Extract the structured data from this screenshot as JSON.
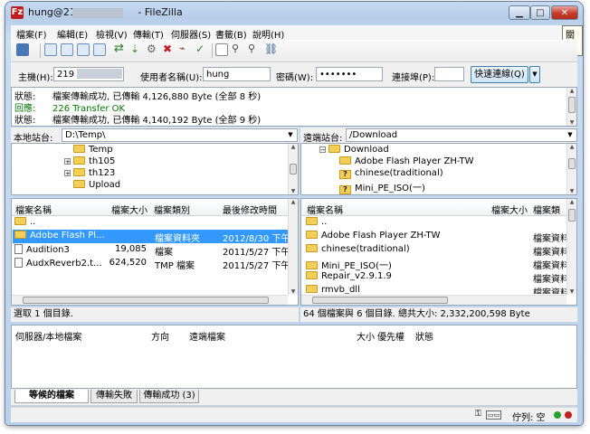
{
  "window": {
    "title_prefix": "hung@219",
    "title_suffix": " - FileZilla",
    "app_icon_glyph": "Fz",
    "help_tooltip": "關閉"
  },
  "menu": [
    "檔案(F)",
    "編輯(E)",
    "檢視(V)",
    "傳輸(T)",
    "伺服器(S)",
    "書籤(B)",
    "說明(H)"
  ],
  "quickconnect": {
    "host_label": "主機(H):",
    "host_value": "219",
    "user_label": "使用者名稱(U):",
    "user_value": "hung",
    "pass_label": "密碼(W):",
    "pass_value": "•••••••",
    "port_label": "連接埠(P):",
    "port_value": "",
    "connect_label": "快速連線(Q)"
  },
  "log": [
    {
      "label": "狀態:",
      "text": "檔案傳輸成功, 已傳輸 4,126,880 Byte (全部 8 秒)",
      "color": "#000000"
    },
    {
      "label": "回應:",
      "text": "226 Transfer OK",
      "color": "#007a00"
    },
    {
      "label": "狀態:",
      "text": "檔案傳輸成功, 已傳輸 4,140,192 Byte (全部 9 秒)",
      "color": "#000000"
    }
  ],
  "local": {
    "path_label": "本地站台:",
    "path_value": "D:\\Temp\\",
    "tree": [
      {
        "name": "Temp",
        "expander": ""
      },
      {
        "name": "th105",
        "expander": "+"
      },
      {
        "name": "th123",
        "expander": "+"
      },
      {
        "name": "Upload",
        "expander": ""
      }
    ],
    "headers": {
      "name": "檔案名稱",
      "size": "檔案大小",
      "type": "檔案類別",
      "modified": "最後修改時間"
    },
    "files": [
      {
        "name": "..",
        "size": "",
        "type": "",
        "modified": "",
        "icon": "folder"
      },
      {
        "name": "Adobe Flash Pl...",
        "size": "",
        "type": "檔案資料夾",
        "modified": "2012/8/30 下午 1...",
        "icon": "folder"
      },
      {
        "name": "Audition3",
        "size": "19,085",
        "type": "檔案",
        "modified": "2011/5/27 下午 0...",
        "icon": "file"
      },
      {
        "name": "AudxReverb2.t...",
        "size": "624,520",
        "type": "TMP 檔案",
        "modified": "2011/5/27 下午 0...",
        "icon": "file"
      }
    ],
    "status": "選取 1 個目錄."
  },
  "remote": {
    "path_label": "遠端站台:",
    "path_value": "/Download",
    "tree": [
      {
        "name": "Download",
        "expander": "−",
        "icon": "folder"
      },
      {
        "name": "Adobe Flash Player ZH-TW",
        "expander": "",
        "icon": "folder"
      },
      {
        "name": "chinese(traditional)",
        "expander": "",
        "icon": "unknown"
      },
      {
        "name": "Mini_PE_ISO(一)",
        "expander": "",
        "icon": "unknown"
      }
    ],
    "headers": {
      "name": "檔案名稱",
      "size": "檔案大小",
      "type": "檔案類"
    },
    "files": [
      {
        "name": "..",
        "type": ""
      },
      {
        "name": "Adobe Flash Player ZH-TW",
        "type": "檔案資料"
      },
      {
        "name": "chinese(traditional)",
        "type": "檔案資料"
      },
      {
        "name": "Mini_PE_ISO(一)",
        "type": "檔案資料"
      },
      {
        "name": "Repair_v2.9.1.9",
        "type": "檔案資料"
      },
      {
        "name": "rmvb_dll",
        "type": "檔案資料"
      }
    ],
    "status": "64 個檔案與 6 個目錄. 總共大小: 2,332,200,598 Byte"
  },
  "queue": {
    "headers": {
      "server": "伺服器/本地檔案",
      "direction": "方向",
      "remote": "遠端檔案",
      "size": "大小",
      "priority": "優先權",
      "status": "狀態"
    }
  },
  "tabs": [
    "等候的檔案",
    "傳輸失敗",
    "傳輸成功 (3)"
  ],
  "statusbar": {
    "queue_text": "佇列: 空"
  }
}
